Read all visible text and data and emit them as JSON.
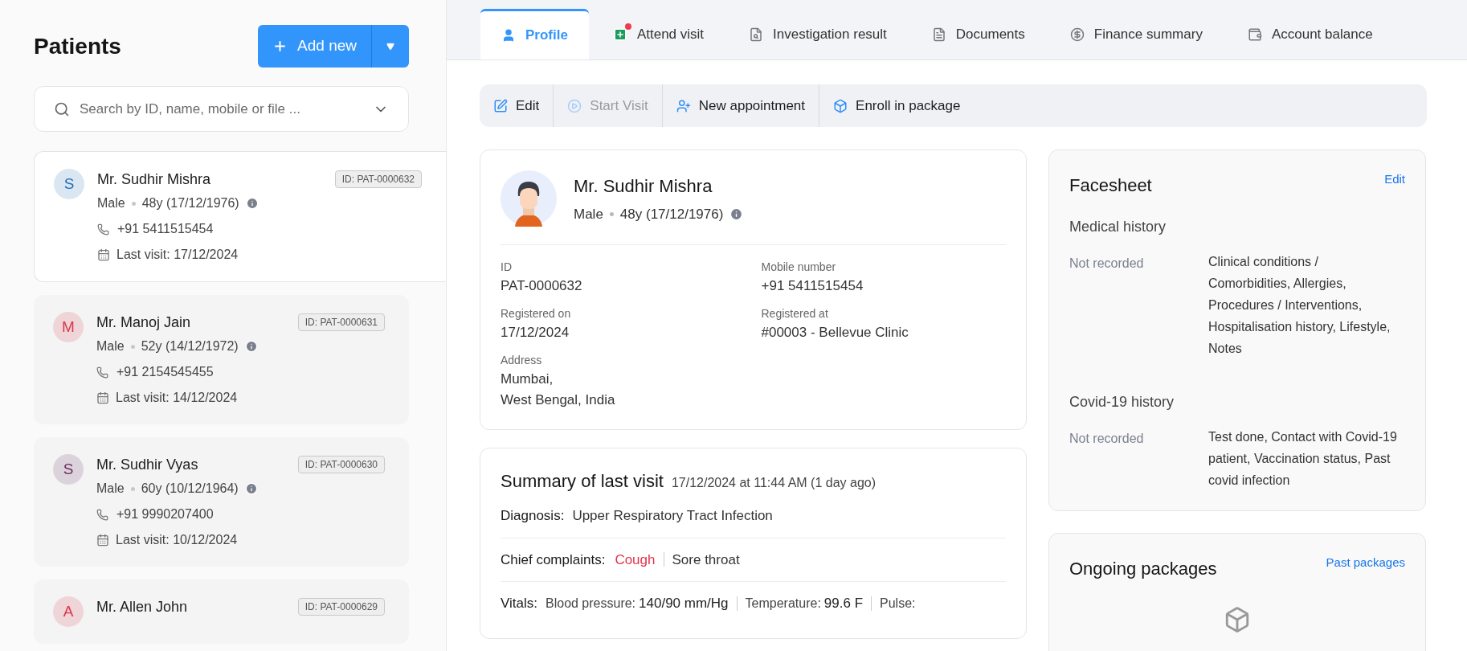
{
  "sidebar": {
    "title": "Patients",
    "add_button": "Add new",
    "search": {
      "placeholder": "Search by ID, name, mobile or file ..."
    },
    "patients": [
      {
        "initial": "S",
        "color": "#1f6fb8",
        "name": "Mr. Sudhir Mishra",
        "id_badge": "ID: PAT-0000632",
        "gender": "Male",
        "age": "48y (17/12/1976)",
        "phone": "+91 5411515454",
        "last_visit": "Last visit: 17/12/2024",
        "selected": true
      },
      {
        "initial": "M",
        "color": "#d9384a",
        "name": "Mr. Manoj Jain",
        "id_badge": "ID: PAT-0000631",
        "gender": "Male",
        "age": "52y (14/12/1972)",
        "phone": "+91 2154545455",
        "last_visit": "Last visit: 14/12/2024",
        "selected": false
      },
      {
        "initial": "S",
        "color": "#6a2d5c",
        "name": "Mr. Sudhir Vyas",
        "id_badge": "ID: PAT-0000630",
        "gender": "Male",
        "age": "60y (10/12/1964)",
        "phone": "+91 9990207400",
        "last_visit": "Last visit: 10/12/2024",
        "selected": false
      },
      {
        "initial": "A",
        "color": "#d9384a",
        "name": "Mr. Allen John",
        "id_badge": "ID: PAT-0000629",
        "selected": false
      }
    ]
  },
  "tabs": [
    {
      "kind": "person",
      "label": "Profile",
      "selected": true,
      "alert": false
    },
    {
      "kind": "medical",
      "label": "Attend visit",
      "selected": false,
      "alert": true
    },
    {
      "kind": "search-doc",
      "label": "Investigation result",
      "selected": false,
      "alert": false
    },
    {
      "kind": "document",
      "label": "Documents",
      "selected": false,
      "alert": false
    },
    {
      "kind": "dollar",
      "label": "Finance summary",
      "selected": false,
      "alert": false
    },
    {
      "kind": "wallet",
      "label": "Account balance",
      "selected": false,
      "alert": false
    }
  ],
  "toolbar": [
    {
      "kind": "edit",
      "label": "Edit",
      "disabled": false
    },
    {
      "kind": "play",
      "label": "Start Visit",
      "disabled": true
    },
    {
      "kind": "person-add",
      "label": "New appointment",
      "disabled": false
    },
    {
      "kind": "cube",
      "label": "Enroll in package",
      "disabled": false
    }
  ],
  "profile": {
    "name": "Mr. Sudhir Mishra",
    "gender": "Male",
    "age": "48y (17/12/1976)",
    "fields": [
      {
        "label": "ID",
        "lines": [
          "PAT-0000632"
        ]
      },
      {
        "label": "Mobile number",
        "lines": [
          "+91 5411515454"
        ]
      },
      {
        "label": "Registered on",
        "lines": [
          "17/12/2024"
        ]
      },
      {
        "label": "Registered at",
        "lines": [
          "#00003 - Bellevue Clinic"
        ]
      },
      {
        "label": "Address",
        "lines": [
          "Mumbai,",
          "West Bengal, India"
        ]
      }
    ]
  },
  "last_visit": {
    "title": "Summary of last visit",
    "when": "17/12/2024 at 11:44 AM (1 day ago)",
    "diagnosis": {
      "label": "Diagnosis:",
      "value": "Upper Respiratory Tract Infection"
    },
    "complaints": {
      "label": "Chief complaints:",
      "items": [
        {
          "text": "Cough",
          "flagged": true
        },
        {
          "text": "Sore throat",
          "flagged": false
        }
      ]
    },
    "vitals": {
      "label": "Vitals:",
      "items": [
        {
          "label": "Blood pressure:",
          "value": "140/90 mm/Hg"
        },
        {
          "label": "Temperature:",
          "value": "99.6 F"
        },
        {
          "label": "Pulse:"
        }
      ]
    }
  },
  "facesheet": {
    "title": "Facesheet",
    "edit": "Edit",
    "sections": [
      {
        "title": "Medical history",
        "status": "Not recorded",
        "detail": "Clinical conditions / Comorbidities, Allergies, Procedures / Interventions, Hospitalisation history, Lifestyle, Notes"
      },
      {
        "title": "Covid-19 history",
        "status": "Not recorded",
        "detail": "Test done, Contact with Covid-19 patient, Vaccination status, Past covid infection"
      }
    ]
  },
  "packages": {
    "title": "Ongoing packages",
    "link": "Past packages"
  }
}
